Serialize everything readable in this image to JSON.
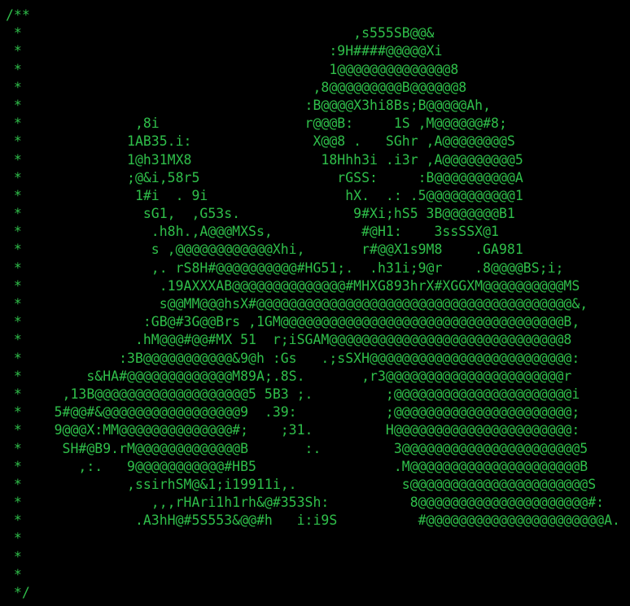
{
  "theme": {
    "background": "#000000",
    "text_color": "#2fbf4a"
  },
  "comment": {
    "lines": [
      "/**",
      " *                                         ,s555SB@@&",
      " *                                      :9H####@@@@@Xi",
      " *                                      1@@@@@@@@@@@@@@8",
      " *                                    ,8@@@@@@@@@B@@@@@@8",
      " *                                   :B@@@@X3hi8Bs;B@@@@@Ah,",
      " *              ,8i                  r@@@B:     1S ,M@@@@@@#8;",
      " *             1AB35.i:               X@@8 .   SGhr ,A@@@@@@@@S",
      " *             1@h31MX8                18Hhh3i .i3r ,A@@@@@@@@@5",
      " *             ;@&i,58r5                 rGSS:     :B@@@@@@@@@@A",
      " *              1#i  . 9i                 hX.  .: .5@@@@@@@@@@@1",
      " *               sG1,  ,G53s.              9#Xi;hS5 3B@@@@@@@B1",
      " *                .h8h.,A@@@MXSs,           #@H1:    3ssSSX@1",
      " *                s ,@@@@@@@@@@@@Xhi,       r#@@X1s9M8    .GA981",
      " *                ,. rS8H#@@@@@@@@@@#HG51;.  .h31i;9@r    .8@@@@BS;i;",
      " *                 .19AXXXAB@@@@@@@@@@@@@@#MHXG893hrX#XGGXM@@@@@@@@@@MS",
      " *                 s@@MM@@@hsX#@@@@@@@@@@@@@@@@@@@@@@@@@@@@@@@@@@@@@@@&,",
      " *               :GB@#3G@@Brs ,1GM@@@@@@@@@@@@@@@@@@@@@@@@@@@@@@@@@@@B,",
      " *              .hM@@@#@@#MX 51  r;iSGAM@@@@@@@@@@@@@@@@@@@@@@@@@@@@@8",
      " *            :3B@@@@@@@@@@@&9@h :Gs   .;sSXH@@@@@@@@@@@@@@@@@@@@@@@@@:",
      " *        s&HA#@@@@@@@@@@@@@M89A;.8S.       ,r3@@@@@@@@@@@@@@@@@@@@@@r",
      " *     ,13B@@@@@@@@@@@@@@@@@@@5 5B3 ;.         ;@@@@@@@@@@@@@@@@@@@@@@i",
      " *    5#@@#&@@@@@@@@@@@@@@@@@9  .39:           ;@@@@@@@@@@@@@@@@@@@@@@;",
      " *    9@@@X:MM@@@@@@@@@@@@@@#;    ;31.         H@@@@@@@@@@@@@@@@@@@@@@:",
      " *     SH#@B9.rM@@@@@@@@@@@@@B       :.         3@@@@@@@@@@@@@@@@@@@@@@5",
      " *       ,:.   9@@@@@@@@@@@#HB5                 .M@@@@@@@@@@@@@@@@@@@@@B",
      " *             ,ssirhSM@&1;i19911i,.             s@@@@@@@@@@@@@@@@@@@@@@S",
      " *                ,,,rHAri1h1rh&@#353Sh:          8@@@@@@@@@@@@@@@@@@@@@#:",
      " *              .A3hH@#5S553&@@#h   i:i9S          #@@@@@@@@@@@@@@@@@@@@@@A.",
      " *",
      " *",
      " *",
      " */"
    ]
  }
}
